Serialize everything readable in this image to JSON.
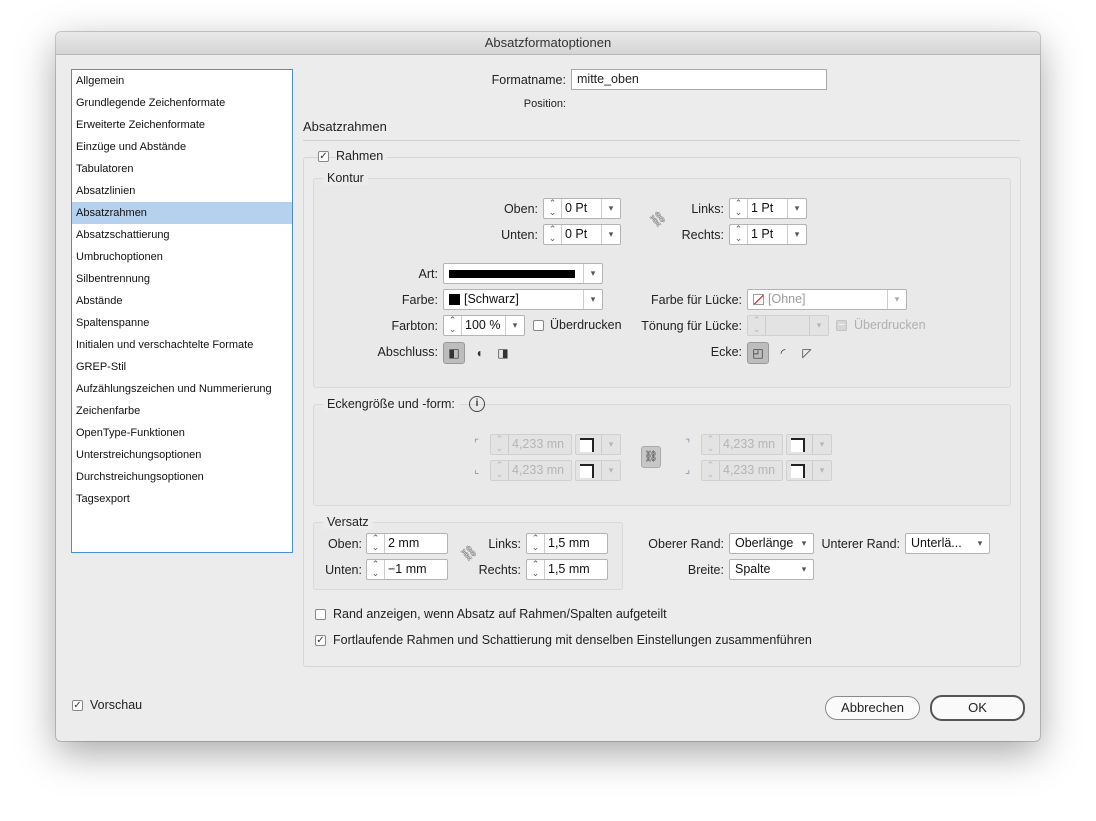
{
  "window": {
    "title": "Absatzformatoptionen"
  },
  "sidebar": {
    "items": [
      {
        "label": "Allgemein"
      },
      {
        "label": "Grundlegende Zeichenformate"
      },
      {
        "label": "Erweiterte Zeichenformate"
      },
      {
        "label": "Einzüge und Abstände"
      },
      {
        "label": "Tabulatoren"
      },
      {
        "label": "Absatzlinien"
      },
      {
        "label": "Absatzrahmen",
        "selected": true
      },
      {
        "label": "Absatzschattierung"
      },
      {
        "label": "Umbruchoptionen"
      },
      {
        "label": "Silbentrennung"
      },
      {
        "label": "Abstände"
      },
      {
        "label": "Spaltenspanne"
      },
      {
        "label": "Initialen und verschachtelte Formate"
      },
      {
        "label": "GREP-Stil"
      },
      {
        "label": "Aufzählungszeichen und Nummerierung"
      },
      {
        "label": "Zeichenfarbe"
      },
      {
        "label": "OpenType-Funktionen"
      },
      {
        "label": "Unterstreichungsoptionen"
      },
      {
        "label": "Durchstreichungsoptionen"
      },
      {
        "label": "Tagsexport"
      }
    ]
  },
  "header": {
    "formatname_label": "Formatname:",
    "formatname_value": "mitte_oben",
    "position_label": "Position:",
    "section_title": "Absatzrahmen"
  },
  "rahmen": {
    "label": "Rahmen",
    "checked": true
  },
  "kontur": {
    "legend": "Kontur",
    "oben_label": "Oben:",
    "oben_value": "0 Pt",
    "unten_label": "Unten:",
    "unten_value": "0 Pt",
    "links_label": "Links:",
    "links_value": "1 Pt",
    "rechts_label": "Rechts:",
    "rechts_value": "1 Pt",
    "art_label": "Art:",
    "farbe_label": "Farbe:",
    "farbe_value": "[Schwarz]",
    "farbe_luecke_label": "Farbe für Lücke:",
    "farbe_luecke_value": "[Ohne]",
    "farbton_label": "Farbton:",
    "farbton_value": "100 %",
    "ueberdrucken_label": "Überdrucken",
    "toenung_label": "Tönung für Lücke:",
    "ueberdrucken2_label": "Überdrucken",
    "abschluss_label": "Abschluss:",
    "ecke_label": "Ecke:"
  },
  "eckform": {
    "legend": "Eckengröße und -form:",
    "values": [
      "4,233 mn",
      "4,233 mn",
      "4,233 mn",
      "4,233 mn"
    ]
  },
  "versatz": {
    "legend": "Versatz",
    "oben_label": "Oben:",
    "oben_value": "2 mm",
    "unten_label": "Unten:",
    "unten_value": "−1 mm",
    "links_label": "Links:",
    "links_value": "1,5 mm",
    "rechts_label": "Rechts:",
    "rechts_value": "1,5 mm",
    "oberer_rand_label": "Oberer Rand:",
    "oberer_rand_value": "Oberlänge",
    "unterer_rand_label": "Unterer Rand:",
    "unterer_rand_value": "Unterlä...",
    "breite_label": "Breite:",
    "breite_value": "Spalte"
  },
  "options": {
    "rand_label": "Rand anzeigen, wenn Absatz auf Rahmen/Spalten aufgeteilt",
    "fortlaufend_label": "Fortlaufende Rahmen und Schattierung mit denselben Einstellungen zusammenführen"
  },
  "footer": {
    "vorschau_label": "Vorschau",
    "cancel_label": "Abbrechen",
    "ok_label": "OK"
  },
  "colors": {
    "selection": "#b6d1ee",
    "sidebar_border": "#4a8fd3",
    "window_bg": "#ececec"
  }
}
